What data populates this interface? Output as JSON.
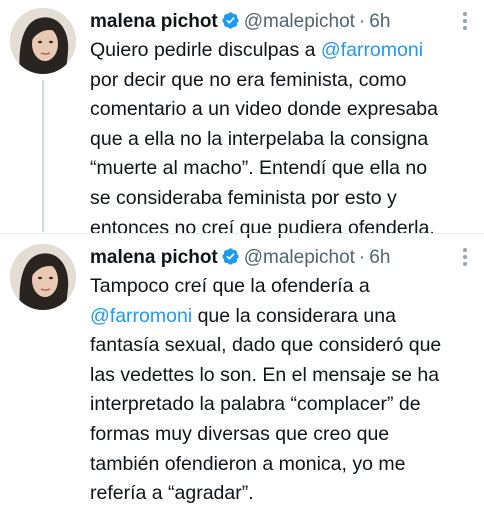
{
  "tweets": [
    {
      "name": "malena pichot",
      "handle": "@malepichot",
      "separator": "·",
      "time": "6h",
      "lines": [
        [
          "Quiero pedirle disculpas a ",
          "@farromoni",
          ""
        ],
        [
          "por decir que no era feminista, como",
          "",
          ""
        ],
        [
          "comentario a un video donde expresaba",
          "",
          ""
        ],
        [
          "que a ella no la interpelaba la consigna",
          "",
          ""
        ],
        [
          "“muerte al macho”. Entendí que ella no",
          "",
          ""
        ],
        [
          "se consideraba feminista por esto y",
          "",
          ""
        ],
        [
          "entonces no creí que pudiera ofenderla.",
          "",
          ""
        ]
      ]
    },
    {
      "name": "malena pichot",
      "handle": "@malepichot",
      "separator": "·",
      "time": "6h",
      "lines": [
        [
          "Tampoco creí que la ofendería a",
          "",
          ""
        ],
        [
          "",
          "@farromoni",
          " que la considerara una"
        ],
        [
          "fantasía sexual, dado que consideró que",
          "",
          ""
        ],
        [
          "las vedettes lo son. En el mensaje se ha",
          "",
          ""
        ],
        [
          "interpretado la palabra “complacer” de",
          "",
          ""
        ],
        [
          "formas muy diversas que creo que",
          "",
          ""
        ],
        [
          "también ofendieron a monica, yo me",
          "",
          ""
        ],
        [
          "refería a “agradar”.",
          "",
          ""
        ]
      ]
    }
  ],
  "colors": {
    "mention": "#1d9bf0",
    "verified": "#1d9bf0",
    "muted": "#536471",
    "text": "#0f1419",
    "thread_line": "#cfd9de"
  },
  "icons": {
    "verified": "verified-badge-icon",
    "more": "more-options-icon"
  }
}
